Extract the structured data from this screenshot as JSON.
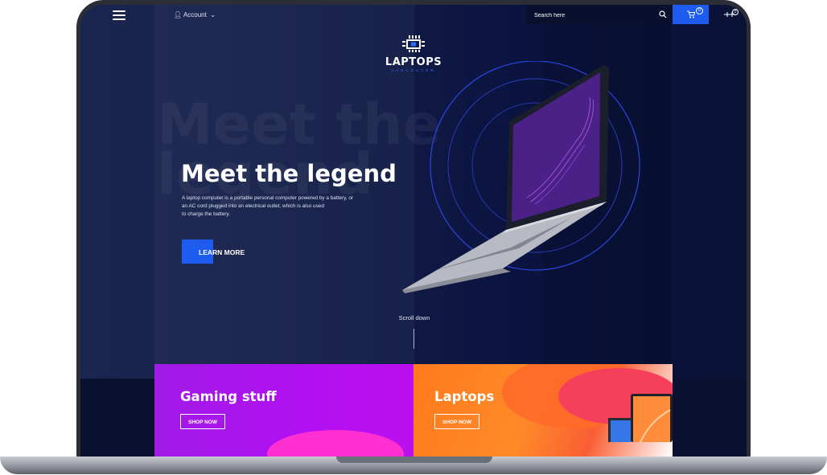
{
  "nav": {
    "account_label": "Account",
    "search_placeholder": "Search here",
    "cart_count": "0",
    "compare_count": "0"
  },
  "logo": {
    "name": "LAPTOPS",
    "sub": "VANCOUVER"
  },
  "hero": {
    "ghost_line1": "Meet the",
    "ghost_line2": "legend",
    "title": "Meet the legend",
    "description_lines": [
      "A laptop computer is a portable personal computer powered by a battery, or",
      "an AC cord plugged into an electrical outlet, which is also used",
      "to charge the battery."
    ],
    "cta_label": "LEARN MORE",
    "scroll_label": "Scroll down"
  },
  "categories": [
    {
      "title": "Gaming stuff",
      "button": "SHOP NOW"
    },
    {
      "title": "Laptops",
      "button": "SHOP NOW"
    }
  ],
  "colors": {
    "accent": "#1e5cf0",
    "hero_bg": "#0f1a3d",
    "gaming_card": "#b210f2",
    "laptops_card": "#ff8a28"
  }
}
